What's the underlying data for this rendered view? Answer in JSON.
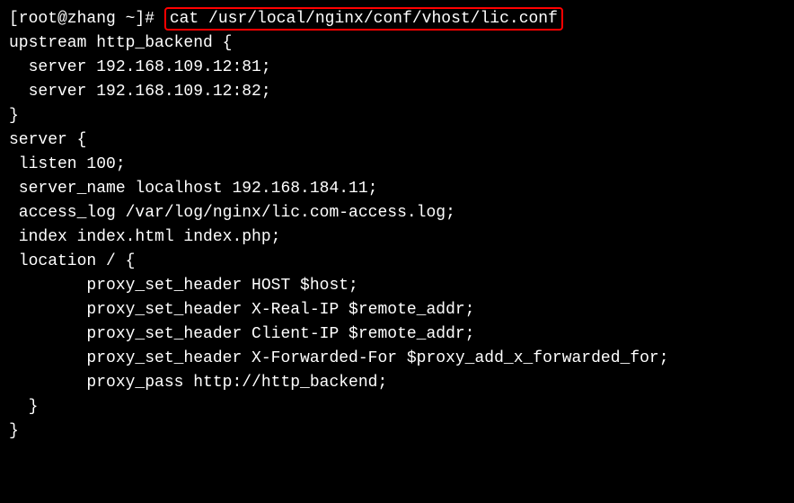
{
  "terminal": {
    "prompt_user": "[root@zhang ~]# ",
    "command": "cat /usr/local/nginx/conf/vhost/lic.conf",
    "output": {
      "line1": "upstream http_backend {",
      "line2": "",
      "line3": "  server 192.168.109.12:81;",
      "line4": "",
      "line5": "  server 192.168.109.12:82;",
      "line6": "",
      "line7": "}",
      "line8": "",
      "line9": "server {",
      "line10": " listen 100;",
      "line11": " server_name localhost 192.168.184.11;",
      "line12": " access_log /var/log/nginx/lic.com-access.log;",
      "line13": " index index.html index.php;",
      "line14": " location / {",
      "line15": "        proxy_set_header HOST $host;",
      "line16": "        proxy_set_header X-Real-IP $remote_addr;",
      "line17": "        proxy_set_header Client-IP $remote_addr;",
      "line18": "        proxy_set_header X-Forwarded-For $proxy_add_x_forwarded_for;",
      "line19": "        proxy_pass http://http_backend;",
      "line20": "  }",
      "line21": "}"
    }
  }
}
